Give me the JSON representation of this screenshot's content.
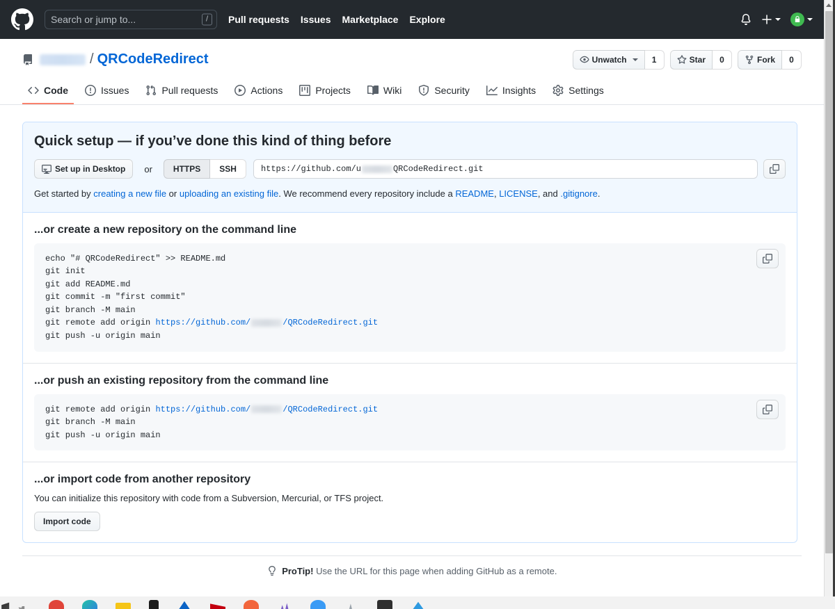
{
  "header": {
    "logo_icon": "github-mark-icon",
    "search": {
      "placeholder": "Search or jump to...",
      "value": "",
      "shortcut_badge": "/"
    },
    "nav": [
      {
        "label": "Pull requests"
      },
      {
        "label": "Issues"
      },
      {
        "label": "Marketplace"
      },
      {
        "label": "Explore"
      }
    ],
    "right": {
      "notifications_icon": "bell-icon",
      "create_new_icon": "plus-icon",
      "create_new_caret": "chevron-down-icon",
      "avatar_icon": "user-avatar-icon",
      "avatar_caret": "chevron-down-icon"
    },
    "colors": {
      "background": "#24292e",
      "text": "#ffffff"
    }
  },
  "repo": {
    "icon": "repo-icon",
    "owner": "",
    "separator": "/",
    "name": "QRCodeRedirect",
    "actions": {
      "watch": {
        "icon": "eye-icon",
        "label": "Unwatch",
        "caret": "chevron-down-icon",
        "count": "1"
      },
      "star": {
        "icon": "star-icon",
        "label": "Star",
        "count": "0"
      },
      "fork": {
        "icon": "fork-icon",
        "label": "Fork",
        "count": "0"
      }
    },
    "tabs": [
      {
        "label": "Code",
        "icon": "code-icon",
        "active": true
      },
      {
        "label": "Issues",
        "icon": "issue-opened-icon",
        "active": false
      },
      {
        "label": "Pull requests",
        "icon": "git-pull-request-icon",
        "active": false
      },
      {
        "label": "Actions",
        "icon": "play-icon",
        "active": false
      },
      {
        "label": "Projects",
        "icon": "project-board-icon",
        "active": false
      },
      {
        "label": "Wiki",
        "icon": "book-icon",
        "active": false
      },
      {
        "label": "Security",
        "icon": "shield-icon",
        "active": false
      },
      {
        "label": "Insights",
        "icon": "graph-icon",
        "active": false
      },
      {
        "label": "Settings",
        "icon": "gear-icon",
        "active": false
      }
    ],
    "active_tab_color": "#f9826c"
  },
  "quick_setup": {
    "heading": "Quick setup — if you’ve done this kind of thing before",
    "desktop_button": {
      "label": "Set up in Desktop",
      "icon": "desktop-download-icon"
    },
    "or_label": "or",
    "protocol_options": [
      {
        "label": "HTTPS",
        "selected": true
      },
      {
        "label": "SSH",
        "selected": false
      }
    ],
    "clone_url_prefix": "https://github.com/u",
    "clone_url_suffix": "QRCodeRedirect.git",
    "copy_icon": "clipboard-icon",
    "get_started": {
      "part1": "Get started by ",
      "link1": "creating a new file",
      "part2": " or ",
      "link2": "uploading an existing file",
      "part3": ". We recommend every repository include a ",
      "link3": "README",
      "part4": ", ",
      "link4": "LICENSE",
      "part5": ", and ",
      "link5": ".gitignore",
      "part6": "."
    },
    "background_color": "#f1f8ff",
    "border_color": "#c8e1ff"
  },
  "create_repo_cli": {
    "heading": "...or create a new repository on the command line",
    "copy_icon": "clipboard-icon",
    "lines": [
      {
        "text": "echo \"# QRCodeRedirect\" >> README.md"
      },
      {
        "text": "git init"
      },
      {
        "text": "git add README.md"
      },
      {
        "text": "git commit -m \"first commit\""
      },
      {
        "text": "git branch -M main"
      },
      {
        "text": "git remote add origin ",
        "link_prefix": "https://github.com/",
        "link_suffix": "/QRCodeRedirect.git"
      },
      {
        "text": "git push -u origin main"
      }
    ]
  },
  "push_existing_cli": {
    "heading": "...or push an existing repository from the command line",
    "copy_icon": "clipboard-icon",
    "lines": [
      {
        "text": "git remote add origin ",
        "link_prefix": "https://github.com/",
        "link_suffix": "/QRCodeRedirect.git"
      },
      {
        "text": "git branch -M main"
      },
      {
        "text": "git push -u origin main"
      }
    ]
  },
  "import_section": {
    "heading": "...or import code from another repository",
    "description": "You can initialize this repository with code from a Subversion, Mercurial, or TFS project.",
    "button_label": "Import code"
  },
  "protip": {
    "icon": "lightbulb-icon",
    "label": "ProTip!",
    "text": " Use the URL for this page when adding GitHub as a remote."
  },
  "scrollbar": {
    "up_arrow_icon": "chevron-up-icon"
  }
}
